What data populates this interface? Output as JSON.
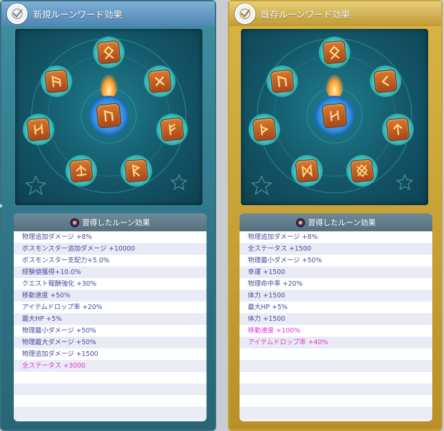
{
  "panels": [
    {
      "id": "new",
      "title": "新規ルーンワード効果",
      "list_header": "習得したルーン効果",
      "effects": [
        {
          "text": "物理追加ダメージ +8%",
          "highlight": false
        },
        {
          "text": "ボスモンスター追加ダメージ +10000",
          "highlight": false
        },
        {
          "text": "ボスモンスター支配力+5.0%",
          "highlight": false
        },
        {
          "text": "経験値獲得+10.0%",
          "highlight": false
        },
        {
          "text": "クエスト報酬強化 +30%",
          "highlight": false
        },
        {
          "text": "移動速度 +50%",
          "highlight": false
        },
        {
          "text": "アイテムドロップ率 +20%",
          "highlight": false
        },
        {
          "text": "最大HP +5%",
          "highlight": false
        },
        {
          "text": "物理最小ダメージ +50%",
          "highlight": false
        },
        {
          "text": "物理最大ダメージ +50%",
          "highlight": false
        },
        {
          "text": "物理追加ダメージ +1500",
          "highlight": false
        },
        {
          "text": "全ステータス +3000",
          "highlight": true
        },
        {
          "text": "",
          "highlight": false
        },
        {
          "text": "",
          "highlight": false
        },
        {
          "text": "",
          "highlight": false
        },
        {
          "text": "",
          "highlight": false
        }
      ],
      "runes": [
        "othala",
        "ansuz",
        "gebo",
        "hagalaz",
        "fehu",
        "tiwaz",
        "raidho",
        "uruz"
      ]
    },
    {
      "id": "existing",
      "title": "既存ルーンワード効果",
      "list_header": "習得したルーン効果",
      "effects": [
        {
          "text": "物理追加ダメージ +8%",
          "highlight": false
        },
        {
          "text": "全ステータス +1500",
          "highlight": false
        },
        {
          "text": "物理最小ダメージ +50%",
          "highlight": false
        },
        {
          "text": "幸運 +1500",
          "highlight": false
        },
        {
          "text": "物理命中率 +20%",
          "highlight": false
        },
        {
          "text": "体力 +1500",
          "highlight": false
        },
        {
          "text": "最大HP +5%",
          "highlight": false
        },
        {
          "text": "体力 +1500",
          "highlight": false
        },
        {
          "text": "移動速度 +100%",
          "highlight": true
        },
        {
          "text": "アイテムドロップ率 +40%",
          "highlight": true
        },
        {
          "text": "",
          "highlight": false
        },
        {
          "text": "",
          "highlight": false
        },
        {
          "text": "",
          "highlight": false
        },
        {
          "text": "",
          "highlight": false
        },
        {
          "text": "",
          "highlight": false
        },
        {
          "text": "",
          "highlight": false
        }
      ],
      "runes": [
        "othala",
        "uruz",
        "kenaz",
        "thurisaz",
        "tiwaz",
        "dagaz",
        "ingwaz",
        "hagalaz"
      ]
    }
  ],
  "colors": {
    "effect_text": "#4d4a9c",
    "effect_highlight": "#e03ad8",
    "left_accent": "#3f8fa1",
    "right_accent": "#d9b544"
  }
}
